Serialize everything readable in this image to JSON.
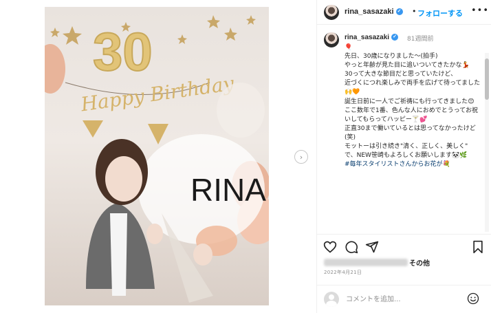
{
  "header": {
    "username": "rina_sasazaki",
    "separator": "•",
    "follow_label": "フォローする",
    "more_label": "•••"
  },
  "caption": {
    "username": "rina_sasazaki",
    "time": "81週間前",
    "lines": [
      "🎈",
      "先日、30歳になりました〜(拍手)",
      "やっと年齢が見た目に追いついてきたかな💃",
      "30って大きな節目だと思っていたけど、",
      "近づくにつれ楽しみで両手を広げて待ってました🙌🧡",
      "誕生日前に一人でご祈祷にも行ってきました😊",
      "ここ数年で1番、色んな人におめでとうってお祝いしてもらってハッピー🍸💕",
      "正直30まで働いているとは思ってなかったけど(笑)",
      "モットーは引き続き\"清く、正しく、美しく\"",
      "で、NEW笹崎もよろしくお願いします🐼🌿"
    ],
    "hashtag": "#毎年スタイリストさんからお花が💐"
  },
  "photo": {
    "balloon_number": "30",
    "banner_text": "Happy Birthday",
    "balloon_text": "RINA"
  },
  "likes": {
    "suffix": "その他"
  },
  "post": {
    "date": "2022年4月21日"
  },
  "comment_box": {
    "placeholder": "コメントを追加..."
  },
  "icons": [
    "heart-icon",
    "comment-icon",
    "share-icon",
    "bookmark-icon",
    "emoji-icon",
    "next-arrow-icon",
    "verified-icon"
  ],
  "colors": {
    "accent": "#0095f6",
    "verified": "#3897f0",
    "text": "#262626",
    "muted": "#8e8e8e",
    "border": "#efefef"
  }
}
